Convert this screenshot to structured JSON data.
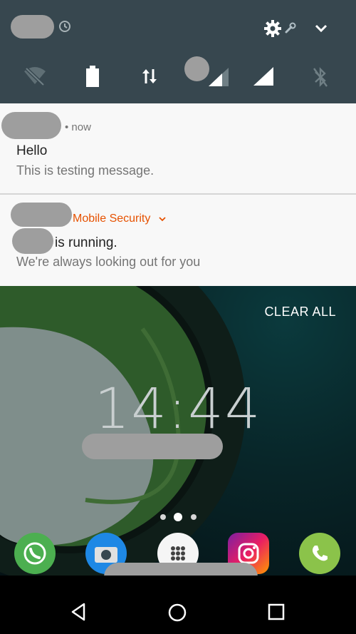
{
  "notifications": [
    {
      "meta": "• now",
      "title": "Hello",
      "text": "This is testing message."
    },
    {
      "app": "Mobile Security",
      "title": "is running.",
      "text": "We're always looking out for you"
    }
  ],
  "lock": {
    "clear_all": "CLEAR ALL",
    "time": "14:44"
  },
  "colors": {
    "accent": "#e65100",
    "panel": "#37474f"
  }
}
